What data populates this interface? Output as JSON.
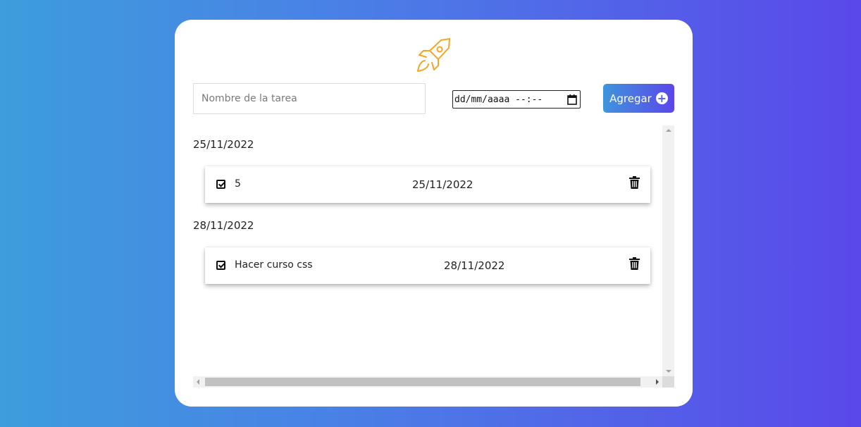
{
  "colors": {
    "background_start": "#3d9ddd",
    "background_end": "#5a48ea",
    "logo_accent": "#f5a623",
    "button_start": "#3f95de",
    "button_end": "#5b46ea"
  },
  "logo": {
    "icon": "rocket-icon"
  },
  "form": {
    "task_placeholder": "Nombre de la tarea",
    "task_value": "",
    "date_placeholder": "dd/mm/aaaa --:--",
    "date_icon": "calendar-icon",
    "add_label": "Agregar",
    "add_icon": "plus-circle-icon"
  },
  "groups": [
    {
      "date": "25/11/2022",
      "tasks": [
        {
          "name": "5",
          "date": "25/11/2022",
          "done": true,
          "check_icon": "checkbox-checked-icon",
          "delete_icon": "trash-icon"
        }
      ]
    },
    {
      "date": "28/11/2022",
      "tasks": [
        {
          "name": "Hacer curso css",
          "date": "28/11/2022",
          "done": true,
          "check_icon": "checkbox-checked-icon",
          "delete_icon": "trash-icon"
        }
      ]
    }
  ]
}
